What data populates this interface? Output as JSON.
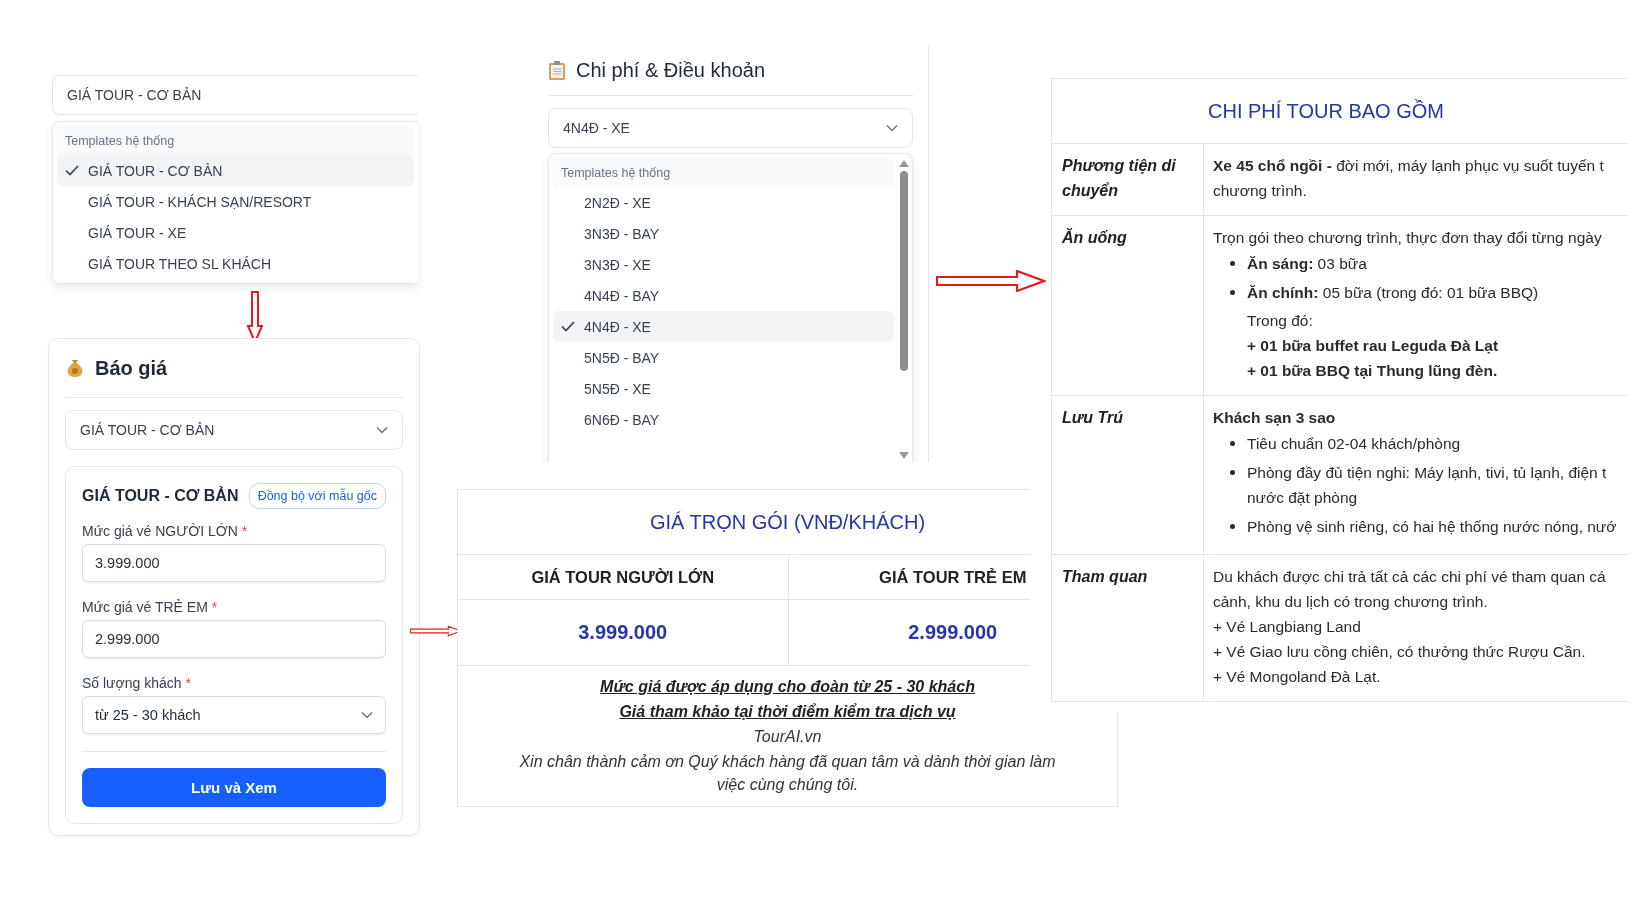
{
  "quick_select": {
    "value": "GIÁ TOUR - CƠ BẢN",
    "group": "Templates hệ thống",
    "options": [
      {
        "label": "GIÁ TOUR - CƠ BẢN",
        "selected": true
      },
      {
        "label": "GIÁ TOUR - KHÁCH SẠN/RESORT",
        "selected": false
      },
      {
        "label": "GIÁ TOUR - XE",
        "selected": false
      },
      {
        "label": "GIÁ TOUR THEO SL KHÁCH",
        "selected": false
      }
    ]
  },
  "quote_panel": {
    "title": "Báo giá",
    "template_select": "GIÁ TOUR - CƠ BẢN",
    "form_title": "GIÁ TOUR - CƠ BẢN",
    "sync_button": "Đồng bộ với mẫu gốc",
    "fields": [
      {
        "label": "Mức giá vé NGƯỜI LỚN",
        "marker": "*",
        "kind": "input",
        "value": "3.999.000"
      },
      {
        "label": "Mức giá vé TRẺ EM",
        "marker": "*",
        "kind": "input",
        "value": "2.999.000"
      },
      {
        "label": "Số lượng khách",
        "marker": "*",
        "kind": "select",
        "value": "từ 25 - 30 khách"
      }
    ],
    "submit": "Lưu và Xem"
  },
  "terms_panel": {
    "title": "Chi phí & Điều khoản",
    "select_value": "4N4Đ - XE",
    "group": "Templates hệ thống",
    "options": [
      {
        "label": "2N2Đ - XE",
        "selected": false
      },
      {
        "label": "3N3Đ - BAY",
        "selected": false
      },
      {
        "label": "3N3Đ - XE",
        "selected": false
      },
      {
        "label": "4N4Đ - BAY",
        "selected": false
      },
      {
        "label": "4N4Đ - XE",
        "selected": true
      },
      {
        "label": "5N5Đ - BAY",
        "selected": false
      },
      {
        "label": "5N5Đ - XE",
        "selected": false
      },
      {
        "label": "6N6Đ - BAY",
        "selected": false
      }
    ]
  },
  "price_table": {
    "title": "GIÁ TRỌN GÓI (VNĐ/KHÁCH)",
    "columns": [
      "GIÁ TOUR NGƯỜI LỚN",
      "GIÁ TOUR TRẺ EM"
    ],
    "values": [
      "3.999.000",
      "2.999.000"
    ],
    "notes": [
      {
        "kind": "emphasis",
        "text": "Mức giá được áp dụng cho đoàn từ 25 - 30 khách"
      },
      {
        "kind": "emphasis",
        "text": "Giá tham khảo tại thời điểm kiểm tra dịch vụ"
      },
      {
        "kind": "plain",
        "text": "TourAI.vn"
      },
      {
        "kind": "plain",
        "text": "Xin chân thành cảm ơn Quý khách hàng đã quan tâm và dành thời gian làm việc cùng chúng tôi."
      }
    ]
  },
  "cost_table": {
    "title": "CHI PHÍ TOUR BAO GỒM",
    "rows": [
      {
        "label": "Phương tiện di chuyển",
        "blocks": [
          {
            "kind": "text",
            "lines": [
              "**Xe 45 chổ ngồi -** đời mới, máy lạnh phục vụ suốt tuyến t",
              "chương trình."
            ]
          }
        ]
      },
      {
        "label": "Ăn uống",
        "blocks": [
          {
            "kind": "text",
            "lines": [
              "Trọn gói theo chương trình, thực đơn thay đổi từng ngày"
            ]
          },
          {
            "kind": "bullet",
            "lines": [
              "**Ăn sáng:** 03 bữa"
            ]
          },
          {
            "kind": "bullet",
            "lines": [
              "**Ăn chính:** 05 bữa (trong đó: 01 bữa BBQ)"
            ]
          },
          {
            "kind": "note",
            "bold": false,
            "lines": [
              "Trong đó:"
            ]
          },
          {
            "kind": "note",
            "bold": true,
            "lines": [
              "+ 01 bữa buffet rau Leguda Đà Lạt",
              "+ 01 bữa BBQ tại Thung lũng đèn."
            ]
          }
        ]
      },
      {
        "label": "Lưu Trú",
        "blocks": [
          {
            "kind": "heading",
            "lines": [
              "Khách sạn 3 sao"
            ]
          },
          {
            "kind": "bullet",
            "lines": [
              "Tiêu chuẩn 02-04 khách/phòng"
            ]
          },
          {
            "kind": "bullet",
            "lines": [
              "Phòng đầy đủ tiện nghi: Máy lạnh, tivi, tủ lạnh, điện t",
              "nước đặt phòng"
            ]
          },
          {
            "kind": "bullet",
            "lines": [
              "Phòng vệ sinh riêng, có hai hệ thống nước nóng, nướ"
            ]
          }
        ]
      },
      {
        "label": "Tham quan",
        "blocks": [
          {
            "kind": "text",
            "lines": [
              "Du khách được chi trả tất cả các chi phí vé tham quan cá",
              "cảnh, khu du lịch có trong chương trình.",
              "+ Vé Langbiang Land",
              "+ Vé Giao lưu cồng chiên, có thưởng thức Rượu Cần.",
              "+ Vé Mongoland Đà Lạt."
            ]
          }
        ]
      }
    ]
  }
}
